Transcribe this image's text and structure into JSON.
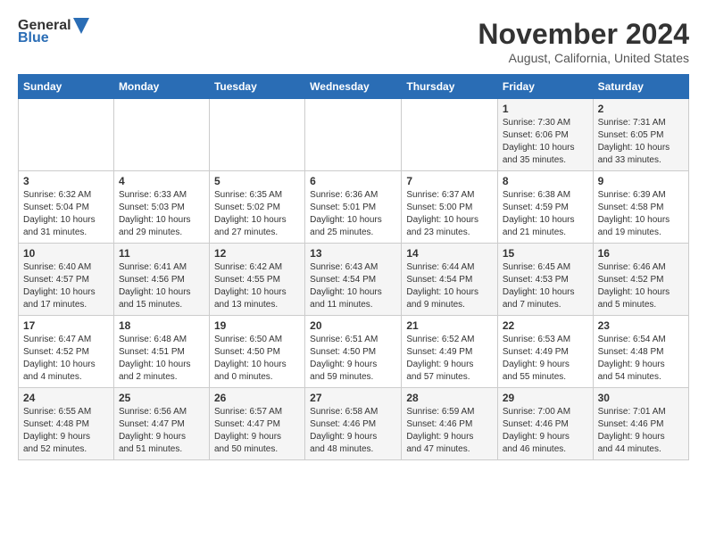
{
  "header": {
    "logo_line1": "General",
    "logo_line2": "Blue",
    "title": "November 2024",
    "subtitle": "August, California, United States"
  },
  "weekdays": [
    "Sunday",
    "Monday",
    "Tuesday",
    "Wednesday",
    "Thursday",
    "Friday",
    "Saturday"
  ],
  "weeks": [
    [
      {
        "day": "",
        "info": ""
      },
      {
        "day": "",
        "info": ""
      },
      {
        "day": "",
        "info": ""
      },
      {
        "day": "",
        "info": ""
      },
      {
        "day": "",
        "info": ""
      },
      {
        "day": "1",
        "info": "Sunrise: 7:30 AM\nSunset: 6:06 PM\nDaylight: 10 hours\nand 35 minutes."
      },
      {
        "day": "2",
        "info": "Sunrise: 7:31 AM\nSunset: 6:05 PM\nDaylight: 10 hours\nand 33 minutes."
      }
    ],
    [
      {
        "day": "3",
        "info": "Sunrise: 6:32 AM\nSunset: 5:04 PM\nDaylight: 10 hours\nand 31 minutes."
      },
      {
        "day": "4",
        "info": "Sunrise: 6:33 AM\nSunset: 5:03 PM\nDaylight: 10 hours\nand 29 minutes."
      },
      {
        "day": "5",
        "info": "Sunrise: 6:35 AM\nSunset: 5:02 PM\nDaylight: 10 hours\nand 27 minutes."
      },
      {
        "day": "6",
        "info": "Sunrise: 6:36 AM\nSunset: 5:01 PM\nDaylight: 10 hours\nand 25 minutes."
      },
      {
        "day": "7",
        "info": "Sunrise: 6:37 AM\nSunset: 5:00 PM\nDaylight: 10 hours\nand 23 minutes."
      },
      {
        "day": "8",
        "info": "Sunrise: 6:38 AM\nSunset: 4:59 PM\nDaylight: 10 hours\nand 21 minutes."
      },
      {
        "day": "9",
        "info": "Sunrise: 6:39 AM\nSunset: 4:58 PM\nDaylight: 10 hours\nand 19 minutes."
      }
    ],
    [
      {
        "day": "10",
        "info": "Sunrise: 6:40 AM\nSunset: 4:57 PM\nDaylight: 10 hours\nand 17 minutes."
      },
      {
        "day": "11",
        "info": "Sunrise: 6:41 AM\nSunset: 4:56 PM\nDaylight: 10 hours\nand 15 minutes."
      },
      {
        "day": "12",
        "info": "Sunrise: 6:42 AM\nSunset: 4:55 PM\nDaylight: 10 hours\nand 13 minutes."
      },
      {
        "day": "13",
        "info": "Sunrise: 6:43 AM\nSunset: 4:54 PM\nDaylight: 10 hours\nand 11 minutes."
      },
      {
        "day": "14",
        "info": "Sunrise: 6:44 AM\nSunset: 4:54 PM\nDaylight: 10 hours\nand 9 minutes."
      },
      {
        "day": "15",
        "info": "Sunrise: 6:45 AM\nSunset: 4:53 PM\nDaylight: 10 hours\nand 7 minutes."
      },
      {
        "day": "16",
        "info": "Sunrise: 6:46 AM\nSunset: 4:52 PM\nDaylight: 10 hours\nand 5 minutes."
      }
    ],
    [
      {
        "day": "17",
        "info": "Sunrise: 6:47 AM\nSunset: 4:52 PM\nDaylight: 10 hours\nand 4 minutes."
      },
      {
        "day": "18",
        "info": "Sunrise: 6:48 AM\nSunset: 4:51 PM\nDaylight: 10 hours\nand 2 minutes."
      },
      {
        "day": "19",
        "info": "Sunrise: 6:50 AM\nSunset: 4:50 PM\nDaylight: 10 hours\nand 0 minutes."
      },
      {
        "day": "20",
        "info": "Sunrise: 6:51 AM\nSunset: 4:50 PM\nDaylight: 9 hours\nand 59 minutes."
      },
      {
        "day": "21",
        "info": "Sunrise: 6:52 AM\nSunset: 4:49 PM\nDaylight: 9 hours\nand 57 minutes."
      },
      {
        "day": "22",
        "info": "Sunrise: 6:53 AM\nSunset: 4:49 PM\nDaylight: 9 hours\nand 55 minutes."
      },
      {
        "day": "23",
        "info": "Sunrise: 6:54 AM\nSunset: 4:48 PM\nDaylight: 9 hours\nand 54 minutes."
      }
    ],
    [
      {
        "day": "24",
        "info": "Sunrise: 6:55 AM\nSunset: 4:48 PM\nDaylight: 9 hours\nand 52 minutes."
      },
      {
        "day": "25",
        "info": "Sunrise: 6:56 AM\nSunset: 4:47 PM\nDaylight: 9 hours\nand 51 minutes."
      },
      {
        "day": "26",
        "info": "Sunrise: 6:57 AM\nSunset: 4:47 PM\nDaylight: 9 hours\nand 50 minutes."
      },
      {
        "day": "27",
        "info": "Sunrise: 6:58 AM\nSunset: 4:46 PM\nDaylight: 9 hours\nand 48 minutes."
      },
      {
        "day": "28",
        "info": "Sunrise: 6:59 AM\nSunset: 4:46 PM\nDaylight: 9 hours\nand 47 minutes."
      },
      {
        "day": "29",
        "info": "Sunrise: 7:00 AM\nSunset: 4:46 PM\nDaylight: 9 hours\nand 46 minutes."
      },
      {
        "day": "30",
        "info": "Sunrise: 7:01 AM\nSunset: 4:46 PM\nDaylight: 9 hours\nand 44 minutes."
      }
    ]
  ]
}
